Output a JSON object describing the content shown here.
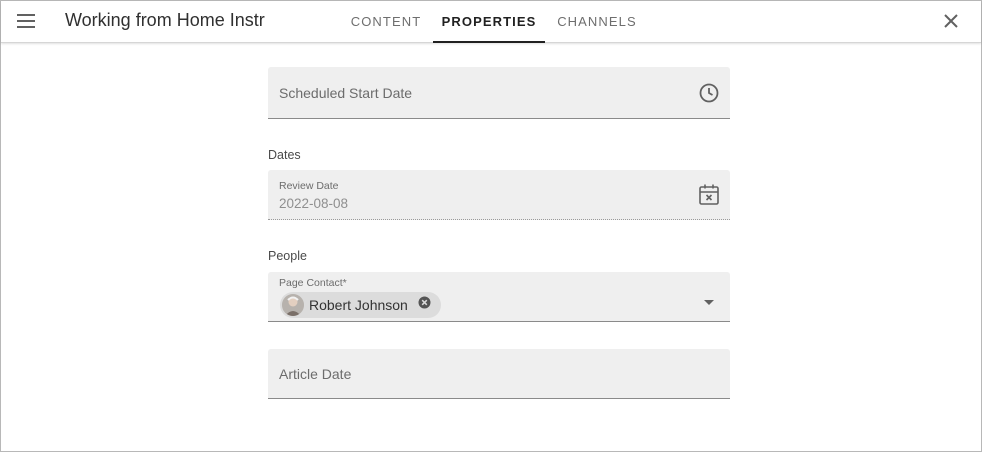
{
  "header": {
    "title": "Working from Home Instr",
    "tabs": [
      {
        "label": "CONTENT",
        "active": false
      },
      {
        "label": "PROPERTIES",
        "active": true
      },
      {
        "label": "CHANNELS",
        "active": false
      }
    ]
  },
  "form": {
    "scheduled_start": {
      "placeholder": "Scheduled Start Date",
      "icon": "clock-icon"
    },
    "dates_section": "Dates",
    "review_date": {
      "label": "Review Date",
      "value": "2022-08-08",
      "icon": "calendar-clear-icon"
    },
    "people_section": "People",
    "page_contact": {
      "label": "Page Contact*",
      "chip": "Robert Johnson",
      "icon": "dropdown-arrow-icon"
    },
    "article_date": {
      "placeholder": "Article Date"
    }
  },
  "colors": {
    "field_bg": "#efefef",
    "active_tab": "#212121",
    "chip_bg": "#dcdcdc"
  }
}
